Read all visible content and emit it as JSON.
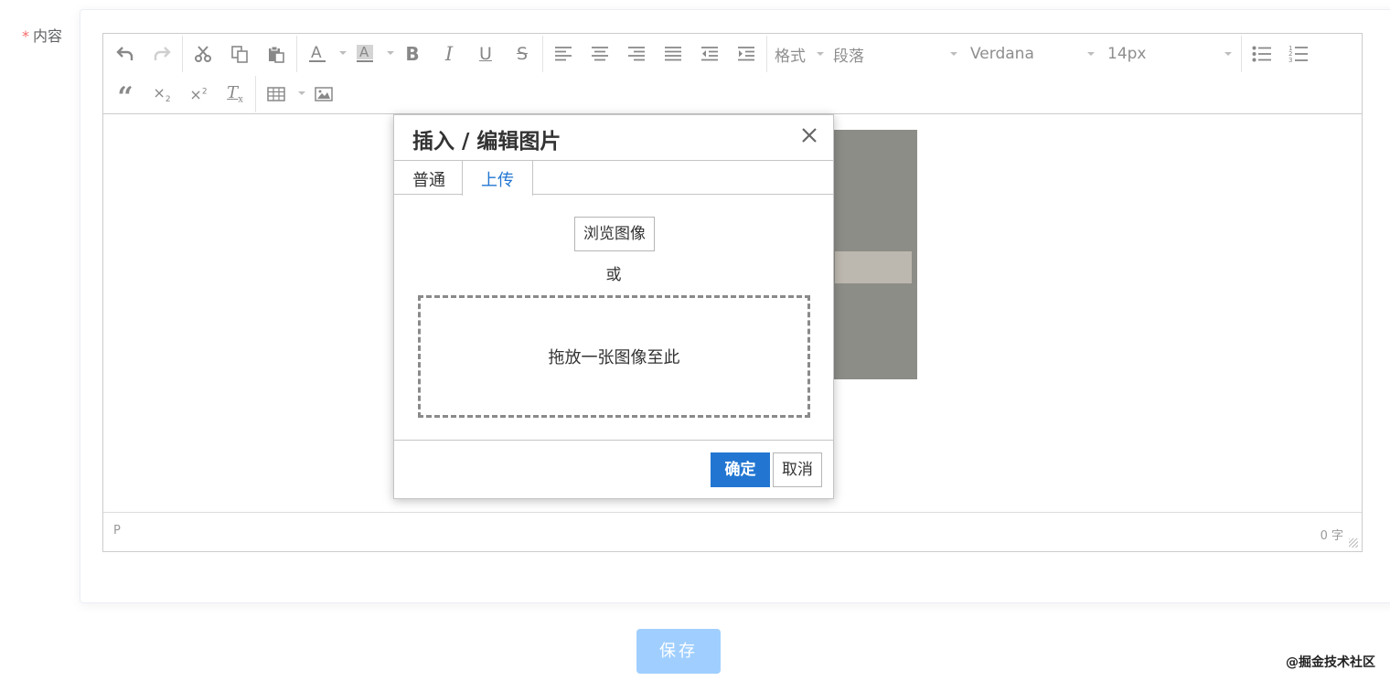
{
  "form": {
    "required_mark": "*",
    "content_label": "内容",
    "save_label": "保存"
  },
  "editor": {
    "format_label": "格式",
    "block_select": "段落",
    "font_select": "Verdana",
    "size_select": "14px",
    "status_path": "P",
    "word_count": "0 字",
    "toolbar_icons": [
      "undo-icon",
      "redo-icon",
      "cut-icon",
      "copy-icon",
      "paste-icon",
      "text-color-icon",
      "background-color-icon",
      "bold-icon",
      "italic-icon",
      "underline-icon",
      "strikethrough-icon",
      "align-left-icon",
      "align-center-icon",
      "align-right-icon",
      "align-justify-icon",
      "outdent-icon",
      "indent-icon",
      "bullet-list-icon",
      "numbered-list-icon",
      "blockquote-icon",
      "subscript-icon",
      "superscript-icon",
      "clear-format-icon",
      "table-icon",
      "image-icon"
    ]
  },
  "dialog": {
    "title": "插入 / 编辑图片",
    "tabs": [
      "普通",
      "上传"
    ],
    "active_tab": "上传",
    "browse_label": "浏览图像",
    "or_text": "或",
    "drop_text": "拖放一张图像至此",
    "ok_label": "确定",
    "cancel_label": "取消"
  },
  "watermark": "@掘金技术社区",
  "colors": {
    "primary": "#2276d2",
    "save_disabled": "#a0cfff",
    "required": "#f56c6c"
  }
}
